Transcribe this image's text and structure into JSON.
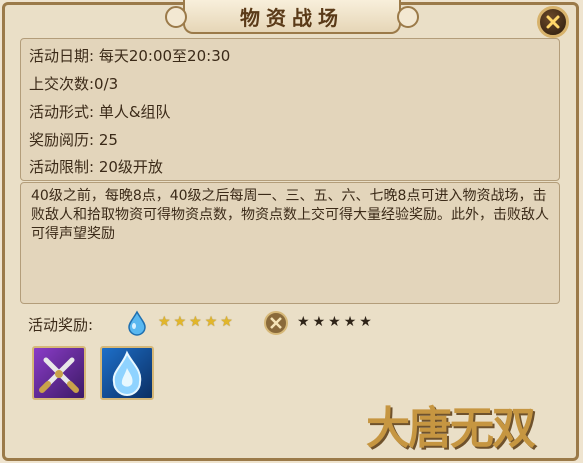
{
  "title": "物资战场",
  "info": {
    "date": "活动日期: 每天20:00至20:30",
    "submit": "上交次数:0/3",
    "form": "活动形式: 单人&组队",
    "reward_exp": "奖励阅历: 25",
    "limit": "活动限制: 20级开放"
  },
  "description": "40级之前，每晚8点，40级之后每周一、三、五、六、七晚8点可进入物资战场，击败敌人和拾取物资可得物资点数，物资点数上交可得大量经验奖励。此外，击败敌人可得声望奖励",
  "rewards": {
    "label": "活动奖励:",
    "exp_stars": 5,
    "prestige_stars": 5
  },
  "logo_text": "大唐无双",
  "icons": [
    "close-icon",
    "water-drop-icon",
    "prestige-coin-icon",
    "crossed-swords-icon",
    "blue-flame-icon"
  ],
  "colors": {
    "panel": "#eadfc7",
    "border": "#9b7a49",
    "text": "#3b2a18",
    "star_gold": "#e2b62a"
  }
}
